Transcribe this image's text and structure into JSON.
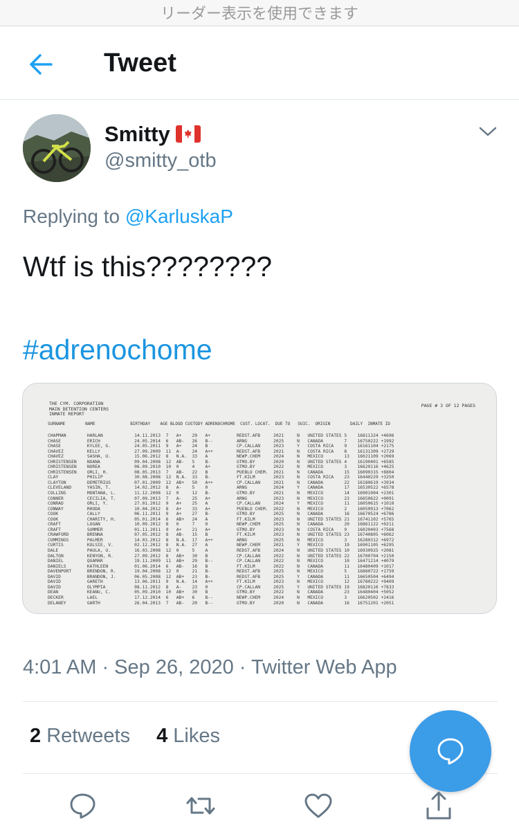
{
  "reader_bar": {
    "text": "リーダー表示を使用できます"
  },
  "header": {
    "title": "Tweet",
    "back_icon": "arrow-left-icon"
  },
  "author": {
    "display_name": "Smitty",
    "flag_icon": "canada-flag-icon",
    "handle": "@smitty_otb",
    "menu_icon": "chevron-down-icon"
  },
  "tweet": {
    "reply_prefix": "Replying to",
    "reply_to": "@KarluskaP",
    "text": "Wtf is this????????",
    "hashtag": "#adrenochome"
  },
  "document": {
    "header_lines": "THE CYM. CORPORATION\nMAIN DETENTION CENTERS\nINMATE REPORT",
    "page_label": "PAGE # 3 OF 12 PAGES",
    "columns": "SURNAME        NAME              BIRTHDAY    AGE BLOOD CUSTODY ADRENOCHROME  CUST. LOCAT.  DUE TO   SUIC.  ORIGIN        DAILY  INMATE ID",
    "rows": [
      "CHAPMAN        HARLAN            14.11.2013  7   A+    29   A+          REDST.AFB     2021     N   UNITED STATES 5    16811324 +4696",
      "CHASE          ERICH             24.05.2014  6   AB-   26   B--         ARNG          2025     N   CANADA        7    16750222 +1992",
      "CHASE          KYLEE, G.         24.05.2011  9   A+    24   B           CP.CALLAN     2023     Y   COSTA RICA    9    16161104 +2175",
      "CHAVEZ         KELLY             27.09.2009  11  A-    24   A++         REDST.AFB     2021     N   COSTA RICA    8    16131309 +2729",
      "CHAVEZ         SASHA, U.         15.06.2012  8   N.A.  33   A           NEWP.CHEM     2024     N   MEXICO        13   16021109 +2069",
      "CHRISTENSEN    NOANA             09.04.2008  12  AB-   5    B-          GTMO.BY       2020     N   UNITED STATES 4    16190401 +6585",
      "CHRISTENSEN    NOREA             06.09.2010  10  0     4    A+          GTMO.BY       2022     N   MEXICO        3    16620116 +4625",
      "CHRISTENSEN    ORLI, H.          08.05.2013  7   AB-   22   B           PUEBLO CHEM.  2021     N   CANADA        15   16090315 +8804",
      "CLAY           PHILIP            30.08.2008  12  N.A.  33   B-          FT.KILM       2023     N   COSTA RICA    23   16440229 +3250",
      "CLAYTON        DEMETRIUS         07.01.2009  12  AB+   50   A++         CP.CALLAN     2021     N   CANADA        22   16180619 +3934",
      "CLEVELAND      YASIN, T.         14.02.2012  8   A-    5    0           ARNG          2024     Y   CANADA        17   16530522 +6578",
      "COLLINS        MONTANA, L.       11.12.2008  12  0     12   B-          GTMO.BY       2021     N   MEXICO        14   16901004 +2301",
      "CONNER         CECILIA, T.       07.09.2013  7   A-    25   A+          ARNG          2023     N   MEXICO        23   16650622 +0091",
      "CONRAD         ORLI, Y.          27.01.2012  9   A+    25   A           CP.CALLAN     2024     Y   MEXICO        11   16050615 +1010",
      "CONWAY         RHODA             10.04.2012  8   A+    33   A+          PUEBLO CHEM.  2022     N   MEXICO        2    16050913 +7062",
      "COOK           CALLY             06.11.2011  9   A+    27   B-          GTMO.BY       2025     N   CANADA        16   16670524 +6786",
      "COOK           CHARITY, H.       05.01.2014  6   AB+   24   A           FT.KILM       2023     N   UNITED STATES 21   16741102 +5765",
      "CRAFT          LOGAN             10.09.2012  8   0     7    0           NEWP.CHEM     2025     N   CANADA        20   16861122 +0211",
      "CRAFT          SUMMER            01.11.2011  9   A+    21   A+          GTMO.BY       2023     N   COSTA RICA    9    16020403 +7568",
      "CRAWFORD       BRENNA            07.05.2012  8   AB-   15   B           FT.KILM       2023     N   UNITED STATES 23   16740805 +6062",
      "CUMMINGS       PALMER            14.03.2012  8   N.A.  17   A++         ARNG          2025     N   MEXICO        3    16280312 +6972",
      "CURTIS         KOLSIE, V.        02.12.2012  8   N.A.  27   A           NEWP.CHEM     2021     Y   MEXICO        19   16901105 +6295",
      "DALE           PAULA, U.         16.03.2008  12  0     5    A           REDST.AFB     2024     N   UNITED STATES 10   16930925 +2081",
      "DALTON         KENYON, R.        27.09.2012  8   AB+   30   B           CP.CALLAN     2022     N   UNITED STATES 22   16700704 +2150",
      "DANIEL         QUAMAR            19.11.2009  11  AB+   29   B--         CP.CALLAN     2022     N   MEXICO        10   16471214 +4079",
      "DANIELS        KATHLEEN          01.06.2014  6   AB-   16   B           FT.KILM       2022     N   CANADA        11   16480409 +1017",
      "DAVENPORT      BRENDON, R.       19.04.2008  12  0     21   B-          REDST.AFB     2025     N   MEXICO        5    16880722 +1759",
      "DAVID          BRANDON, J.       06.05.2008  12  AB+   23   B-          REDST.AFB     2025     Y   CANADA        11   16650504 +6494",
      "DAVID          GARETH            13.06.2011  9   N.A.  14   A++         FT.KILM       2023     N   MEXICO        12   16780222 +9409",
      "DAVID          OLYMPIA           08.11.2012  8   A-    23   0           CP.CALLAN     2025     Y   UNITED STATES 19   16820116 +7833",
      "DEAN           KEANU, C.         05.09.2010  10  AB+   30   B           GTMO.BY       2022     N   CANADA        23   16480404 +5052",
      "DECKER         LAEL              17.12.2014  6   AB+   6    B--         NEWP.CHEM     2024     N   MEXICO        3    16620502 +2416",
      "DELANEY        GARTH             26.04.2013  7   AB-   20   B--         GTMO.BY       2020     N   CANADA        16   16751201 +2051"
    ]
  },
  "meta": {
    "timestamp": "4:01 AM · Sep 26, 2020 · Twitter Web App"
  },
  "stats": {
    "retweets_count": "2",
    "retweets_label": "Retweets",
    "likes_count": "4",
    "likes_label": "Likes"
  },
  "actions": {
    "compose_icon": "compose-reply-icon",
    "reply_icon": "reply-icon",
    "retweet_icon": "retweet-icon",
    "like_icon": "heart-icon",
    "share_icon": "share-icon"
  },
  "colors": {
    "accent": "#1da1f2",
    "fab": "#3b9ce8",
    "muted_text": "#657786"
  }
}
